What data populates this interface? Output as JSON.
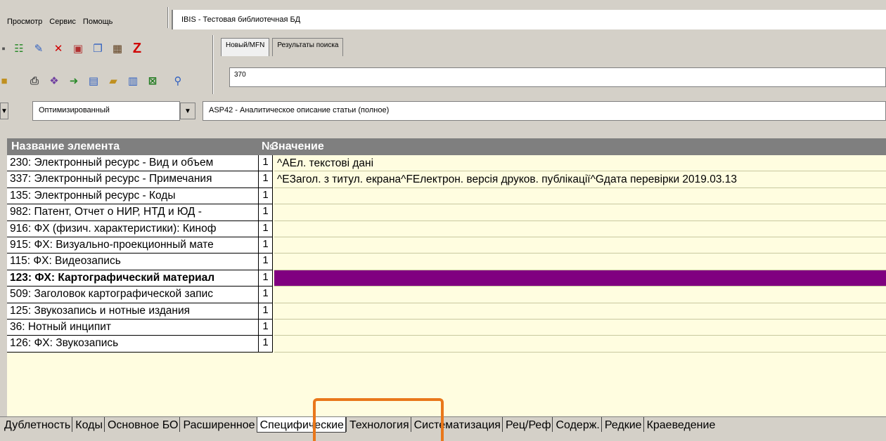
{
  "menu": [
    "Просмотр",
    "Сервис",
    "Помощь"
  ],
  "title_field": "IBIS - Тестовая библиотечная БД",
  "top_tabs": [
    {
      "label": "Новый/MFN",
      "active": true
    },
    {
      "label": "Результаты поиска",
      "active": false
    }
  ],
  "mfn_value": "370",
  "mode_combo": "Оптимизированный",
  "worksheet_combo": "ASP42 - Аналитическое описание статьи (полное)",
  "grid": {
    "header": {
      "name": "Название элемента",
      "num": "№",
      "value": "Значение"
    },
    "rows": [
      {
        "name": "230: Электронный ресурс - Вид и объем",
        "num": "1",
        "value": "^AЕл. текстові дані"
      },
      {
        "name": "337: Электронный ресурс - Примечания",
        "num": "1",
        "value": "^EЗагол. з титул. екрана^FЕлектрон. версія друков. публікації^Gдата перевірки 2019.03.13"
      },
      {
        "name": "135: Электронный ресурс - Коды",
        "num": "1",
        "value": ""
      },
      {
        "name": "982: Патент, Отчет о НИР, НТД и ЮД -",
        "num": "1",
        "value": ""
      },
      {
        "name": "916: ФХ (физич. характеристики): Киноф",
        "num": "1",
        "value": ""
      },
      {
        "name": "915: ФХ: Визуально-проекционный мате",
        "num": "1",
        "value": ""
      },
      {
        "name": "115: ФХ: Видеозапись",
        "num": "1",
        "value": ""
      },
      {
        "name": "123: ФХ: Картографический материал",
        "num": "1",
        "value": "",
        "bold": true,
        "selected": true
      },
      {
        "name": "509: Заголовок картографической запис",
        "num": "1",
        "value": ""
      },
      {
        "name": "125: Звукозапись и нотные издания",
        "num": "1",
        "value": ""
      },
      {
        "name": "36: Нотный инципит",
        "num": "1",
        "value": ""
      },
      {
        "name": "126: ФХ: Звукозапись",
        "num": "1",
        "value": ""
      }
    ]
  },
  "bottom_tabs": [
    {
      "label": "Дублетность",
      "active": false
    },
    {
      "label": "Коды",
      "active": false
    },
    {
      "label": "Основное БО",
      "active": false
    },
    {
      "label": "Расширенное",
      "active": false
    },
    {
      "label": "Специфические",
      "active": true
    },
    {
      "label": "Технология",
      "active": false
    },
    {
      "label": "Систематизация",
      "active": false
    },
    {
      "label": "Рец/Реф",
      "active": false
    },
    {
      "label": "Содерж.",
      "active": false
    },
    {
      "label": "Редкие",
      "active": false
    },
    {
      "label": "Краеведение",
      "active": false
    }
  ],
  "colors": {
    "selection": "#800080",
    "grid_bg": "#fffde0",
    "highlight": "#e9771b"
  }
}
